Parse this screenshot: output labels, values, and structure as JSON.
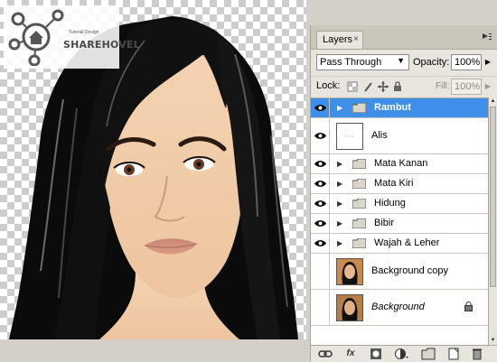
{
  "watermark": {
    "brand": "SHAREHOVEL",
    "subtitle": "Tutorial Design"
  },
  "panel": {
    "tab_label": "Layers",
    "blend_mode": "Pass Through",
    "opacity_label": "Opacity:",
    "opacity_value": "100%",
    "lock_label": "Lock:",
    "fill_label": "Fill:",
    "fill_value": "100%",
    "layers": [
      {
        "name": "Rambut",
        "type": "group",
        "visible": true,
        "selected": true
      },
      {
        "name": "Alis",
        "type": "layer",
        "visible": true,
        "selected": false
      },
      {
        "name": "Mata Kanan",
        "type": "group",
        "visible": true,
        "selected": false
      },
      {
        "name": "Mata Kiri",
        "type": "group",
        "visible": true,
        "selected": false
      },
      {
        "name": "Hidung",
        "type": "group",
        "visible": true,
        "selected": false
      },
      {
        "name": "Bibir",
        "type": "group",
        "visible": true,
        "selected": false
      },
      {
        "name": "Wajah & Leher",
        "type": "group",
        "visible": true,
        "selected": false
      },
      {
        "name": "Background copy",
        "type": "image",
        "visible": false,
        "selected": false
      },
      {
        "name": "Background",
        "type": "image",
        "visible": false,
        "selected": false,
        "locked": true
      }
    ],
    "footer_icons": [
      "link-icon",
      "fx-icon",
      "mask-icon",
      "adjustment-icon",
      "new-group-icon",
      "new-layer-icon",
      "trash-icon"
    ]
  },
  "colors": {
    "selection": "#3f8ee8",
    "panel_bg": "#e7e5dd",
    "chrome": "#d4d0c8"
  }
}
